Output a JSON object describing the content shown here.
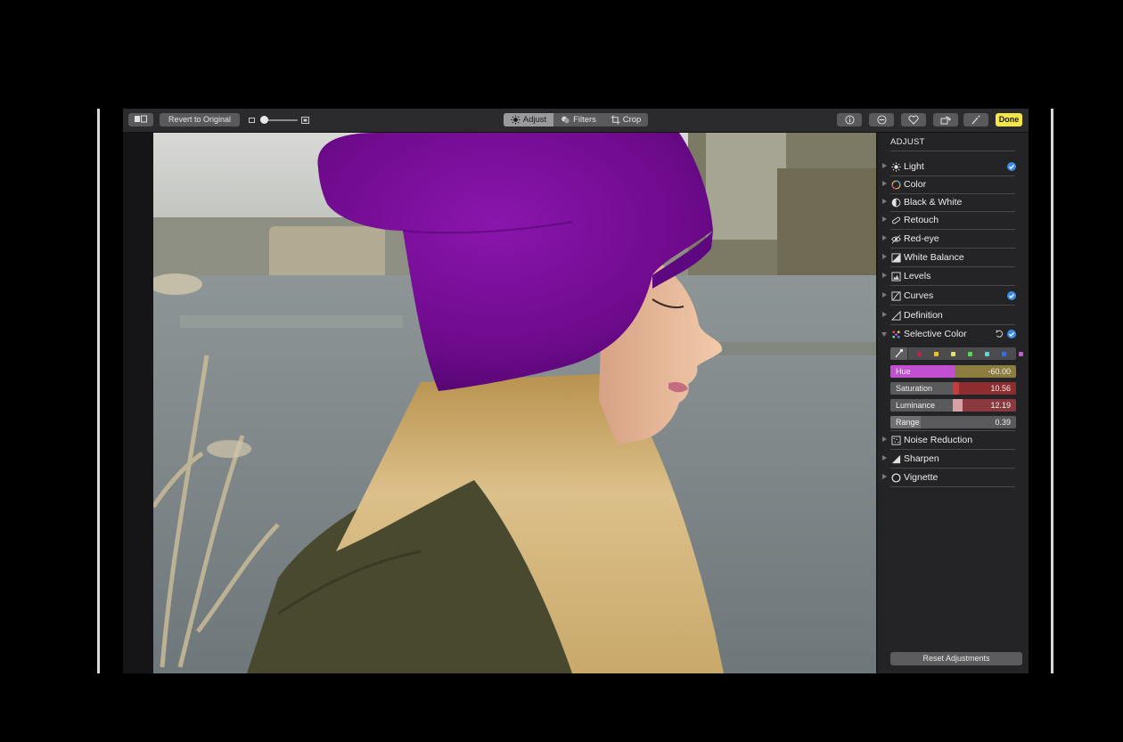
{
  "toolbar": {
    "revert_label": "Revert to Original",
    "zoom_level": 0.05,
    "tabs": [
      {
        "label": "Adjust",
        "active": true
      },
      {
        "label": "Filters",
        "active": false
      },
      {
        "label": "Crop",
        "active": false
      }
    ],
    "right_icons": [
      "info-icon",
      "minus-circle-icon",
      "heart-icon",
      "rotate-icon",
      "magic-wand-icon"
    ],
    "done_label": "Done"
  },
  "sidebar": {
    "title": "ADJUST",
    "items": [
      {
        "label": "Light",
        "icon": "sun-icon",
        "checked": true
      },
      {
        "label": "Color",
        "icon": "color-circle-icon",
        "checked": false
      },
      {
        "label": "Black & White",
        "icon": "half-circle-icon",
        "checked": false
      },
      {
        "label": "Retouch",
        "icon": "bandage-icon",
        "checked": false
      },
      {
        "label": "Red-eye",
        "icon": "eye-icon",
        "checked": false
      },
      {
        "label": "White Balance",
        "icon": "white-balance-icon",
        "checked": false
      },
      {
        "label": "Levels",
        "icon": "histogram-icon",
        "checked": false
      },
      {
        "label": "Curves",
        "icon": "curves-icon",
        "checked": true
      },
      {
        "label": "Definition",
        "icon": "triangle-icon",
        "checked": false
      },
      {
        "label": "Selective Color",
        "icon": "color-dots-icon",
        "checked": true,
        "expanded": true
      }
    ],
    "selective_color": {
      "swatch_colors": [
        "#c81e4a",
        "#e2c33a",
        "#e6e05a",
        "#5ed35a",
        "#57d8d4",
        "#3b6de0",
        "#c25ad8"
      ],
      "sliders": [
        {
          "label": "Hue",
          "value": "-60.00"
        },
        {
          "label": "Saturation",
          "value": "10.56"
        },
        {
          "label": "Luminance",
          "value": "12.19"
        },
        {
          "label": "Range",
          "value": "0.39"
        }
      ]
    },
    "items_after": [
      {
        "label": "Noise Reduction",
        "icon": "noise-icon"
      },
      {
        "label": "Sharpen",
        "icon": "sharpen-triangle-icon"
      },
      {
        "label": "Vignette",
        "icon": "vignette-icon"
      }
    ],
    "reset_label": "Reset Adjustments"
  },
  "colors": {
    "accent_check": "#3d8be4",
    "done_button": "#f2e64a",
    "hat": "#7a0f9a"
  }
}
